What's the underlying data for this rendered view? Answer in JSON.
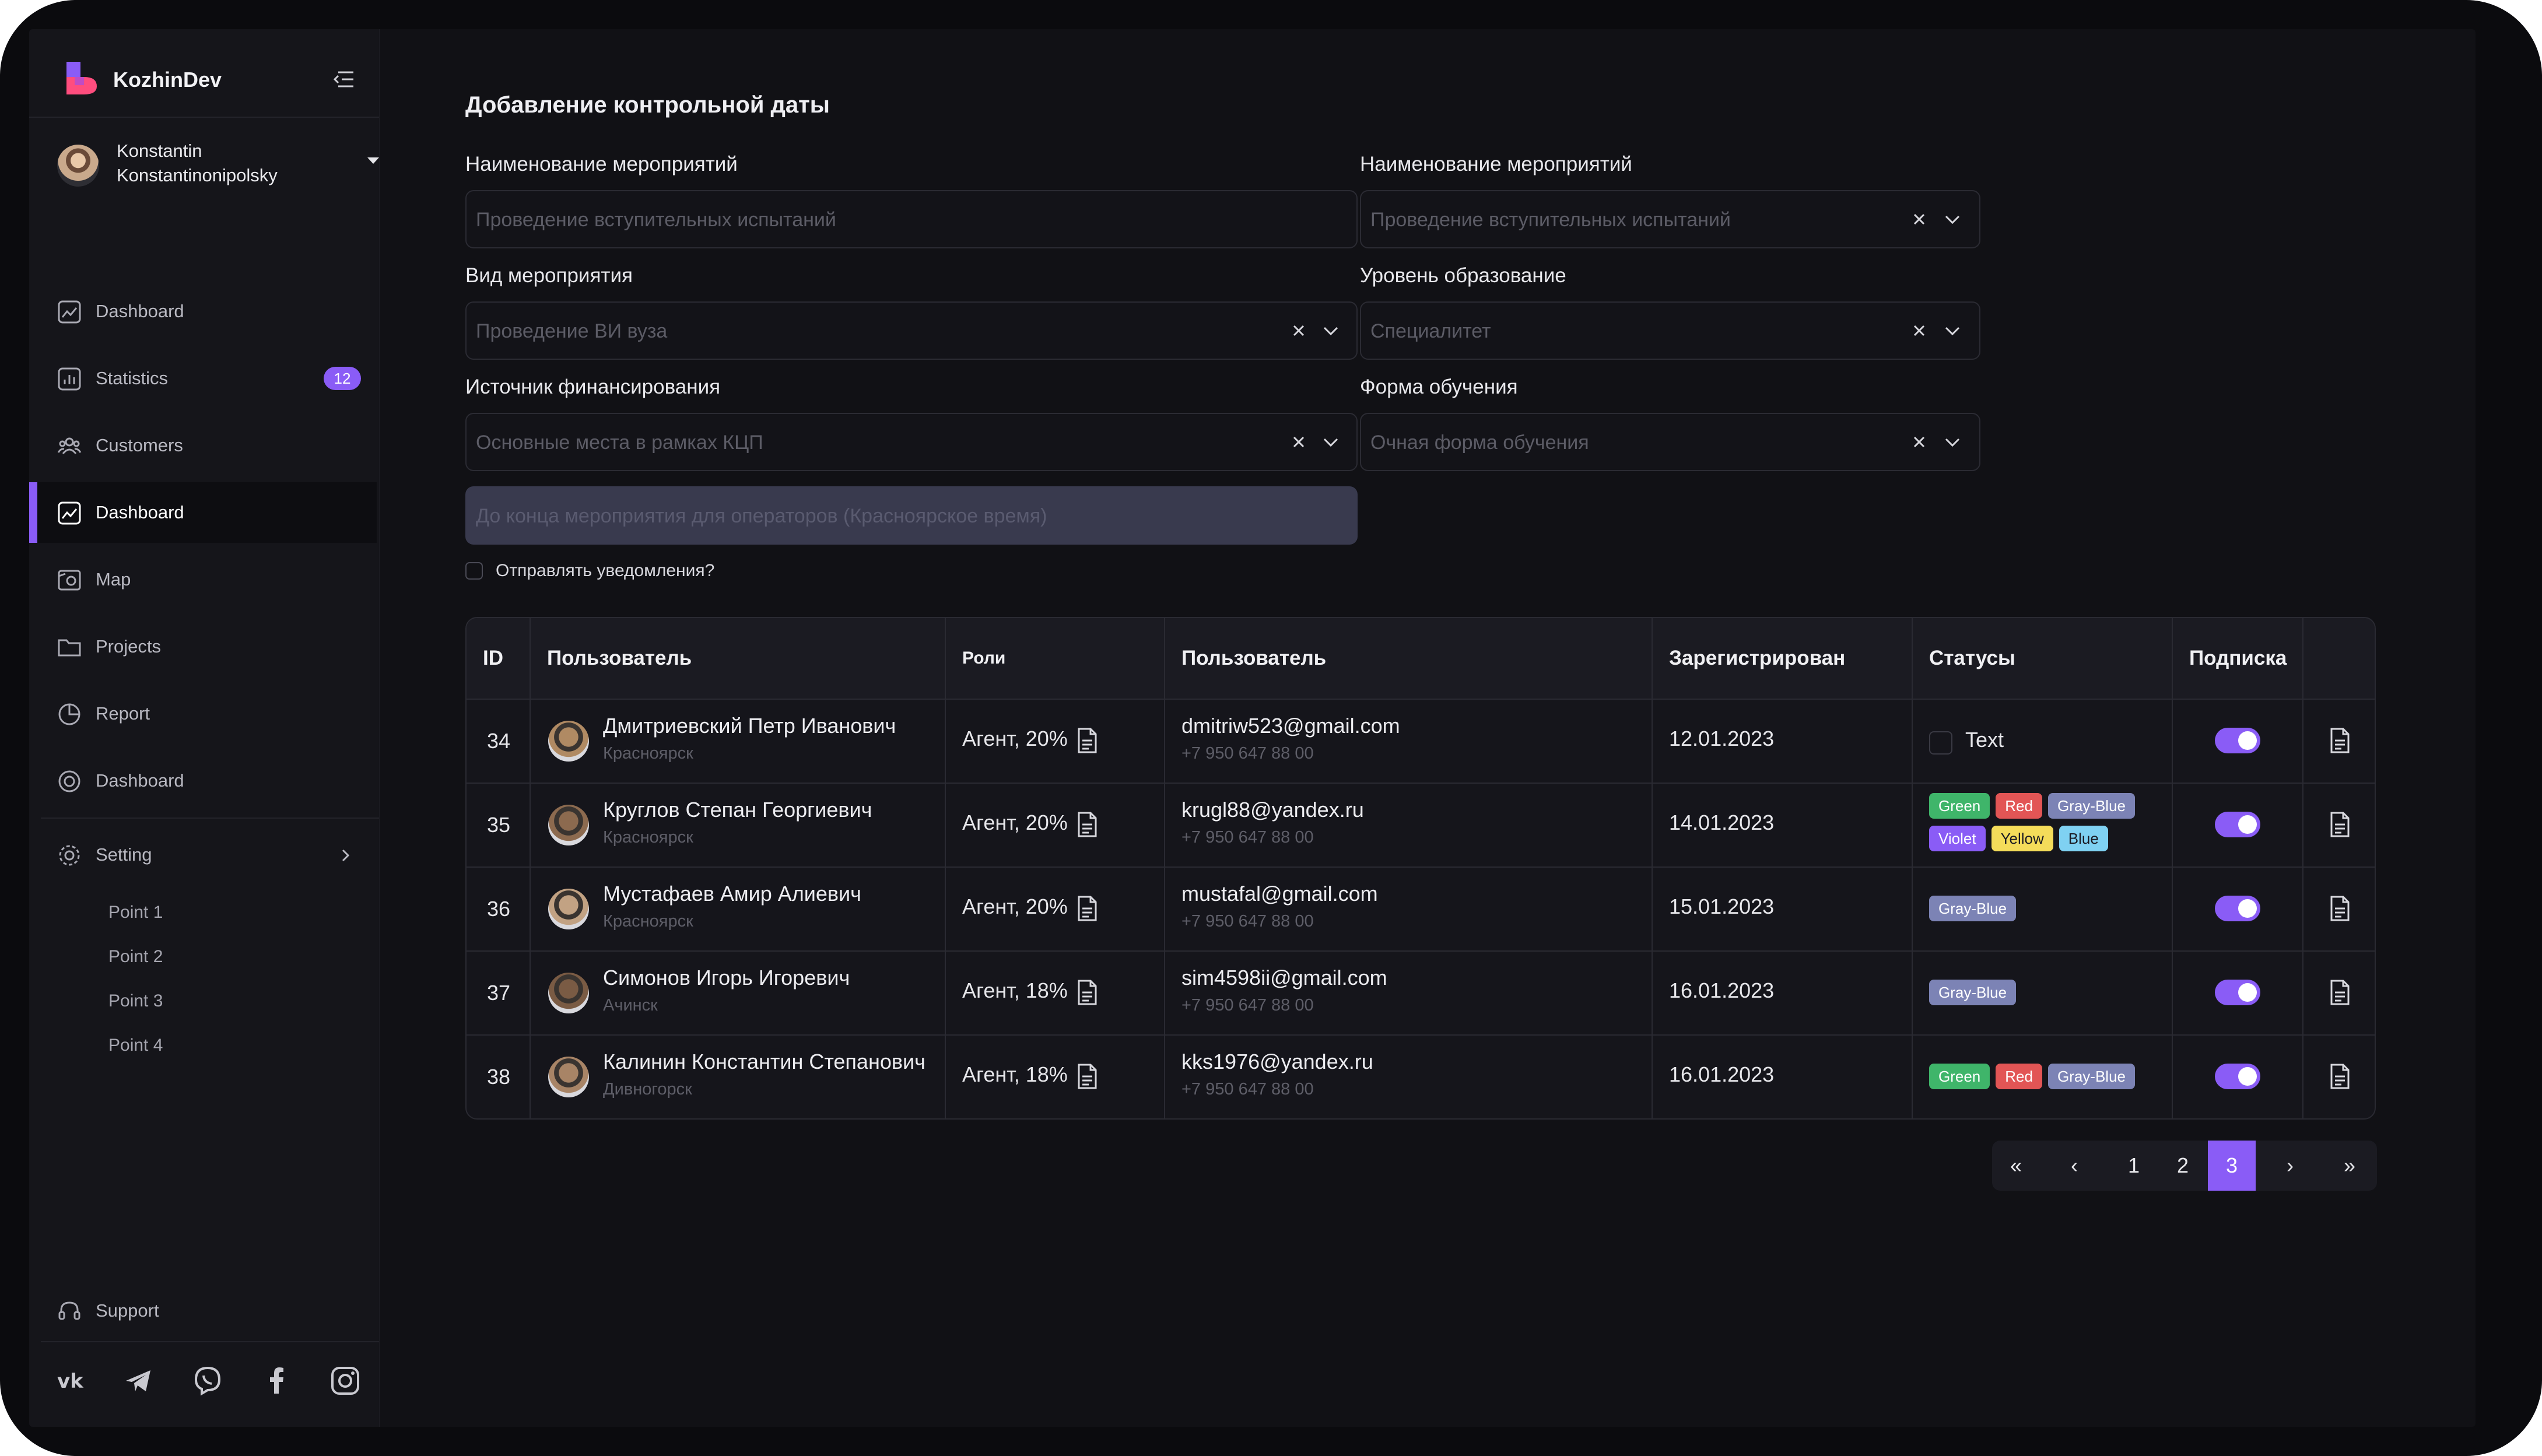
{
  "brand": {
    "name": "KozhinDev"
  },
  "user": {
    "name": "Konstantin Konstantinonipolsky"
  },
  "sidebar": {
    "items": [
      {
        "label": "Dashboard"
      },
      {
        "label": "Statistics",
        "badge": "12"
      },
      {
        "label": "Customers"
      },
      {
        "label": "Dashboard"
      },
      {
        "label": "Map"
      },
      {
        "label": "Projects"
      },
      {
        "label": "Report"
      },
      {
        "label": "Dashboard"
      },
      {
        "label": "Setting"
      }
    ],
    "subitems": [
      "Point 1",
      "Point 2",
      "Point 3",
      "Point 4"
    ],
    "support": "Support",
    "social": [
      "vk-icon",
      "telegram-icon",
      "viber-icon",
      "facebook-icon",
      "instagram-icon"
    ]
  },
  "form": {
    "title": "Добавление контрольной даты",
    "fields": [
      {
        "label": "Наименование мероприятий",
        "placeholder": "Проведение вступительных испытаний"
      },
      {
        "label": "Наименование мероприятий",
        "placeholder": "Проведение вступительных испытаний"
      },
      {
        "label": "Вид мероприятия",
        "placeholder": "Проведение ВИ вуза"
      },
      {
        "label": "Уровень  образование",
        "placeholder": "Специалитет"
      },
      {
        "label": "Источник финансирования",
        "placeholder": "Основные места в рамках КЦП"
      },
      {
        "label": "Форма обучения",
        "placeholder": "Очная форма обучения"
      }
    ],
    "deadline_placeholder": "До конца мероприятия для операторов (Красноярское время)",
    "notify_label": "Отправлять уведомления?"
  },
  "table": {
    "headers": [
      "ID",
      "Пользователь",
      "Роли",
      "Пользователь",
      "Зарегистрирован",
      "Статусы",
      "Подписка"
    ],
    "rows": [
      {
        "id": "34",
        "name": "Дмитриевский Петр Иванович",
        "city": "Красноярск",
        "role": "Агент, 20%",
        "email": "dmitriw523@gmail.com",
        "phone": "+7 950 647 88 00",
        "date": "12.01.2023",
        "status_text": "Text",
        "tags": []
      },
      {
        "id": "35",
        "name": "Круглов Степан Георгиевич",
        "city": "Красноярск",
        "role": "Агент, 20%",
        "email": "krugl88@yandex.ru",
        "phone": "+7 950 647 88 00",
        "date": "14.01.2023",
        "status_text": "",
        "tags": [
          "Green",
          "Red",
          "Gray-Blue",
          "Violet",
          "Yellow",
          "Blue"
        ]
      },
      {
        "id": "36",
        "name": "Мустафаев Амир Алиевич",
        "city": "Красноярск",
        "role": "Агент, 20%",
        "email": "mustafal@gmail.com",
        "phone": "+7 950 647 88 00",
        "date": "15.01.2023",
        "status_text": "",
        "tags": [
          "Gray-Blue"
        ]
      },
      {
        "id": "37",
        "name": "Симонов Игорь Игоревич",
        "city": "Ачинск",
        "role": "Агент, 18%",
        "email": "sim4598ii@gmail.com",
        "phone": "+7 950 647 88 00",
        "date": "16.01.2023",
        "status_text": "",
        "tags": [
          "Gray-Blue"
        ]
      },
      {
        "id": "38",
        "name": "Калинин Константин Степанович",
        "city": "Дивногорск",
        "role": "Агент, 18%",
        "email": "kks1976@yandex.ru",
        "phone": "+7 950 647 88 00",
        "date": "16.01.2023",
        "status_text": "",
        "tags": [
          "Green",
          "Red",
          "Gray-Blue"
        ]
      }
    ]
  },
  "pagination": {
    "first": "«",
    "prev": "‹",
    "pages": [
      "1",
      "2",
      "3"
    ],
    "current": "3",
    "next": "›",
    "last": "»"
  },
  "colors": {
    "accent": "#8a5cf6",
    "tags": {
      "Green": "#3fb56a",
      "Red": "#e25555",
      "Gray-Blue": "#7c83b5",
      "Violet": "#8a5cf6",
      "Yellow": "#f4dc5a",
      "Blue": "#7fd1f2"
    }
  }
}
